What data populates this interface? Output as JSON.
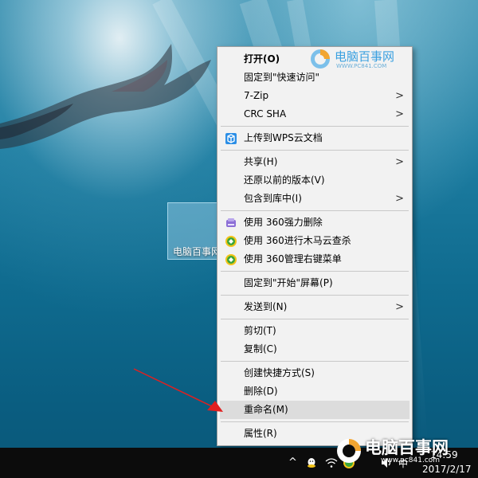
{
  "desktop": {
    "selected_icon_label": "电脑百事网"
  },
  "context_menu": {
    "items": [
      {
        "label": "打开(O)",
        "bold": true
      },
      {
        "label": "固定到\"快速访问\""
      },
      {
        "label": "7-Zip",
        "submenu": true
      },
      {
        "label": "CRC SHA",
        "submenu": true
      },
      {
        "label": "上传到WPS云文档",
        "icon": "wps-cloud-icon"
      },
      {
        "label": "共享(H)",
        "submenu": true
      },
      {
        "label": "还原以前的版本(V)"
      },
      {
        "label": "包含到库中(I)",
        "submenu": true
      },
      {
        "label": "使用 360强力删除",
        "icon": "360-shred-icon"
      },
      {
        "label": "使用 360进行木马云查杀",
        "icon": "360-scan-icon"
      },
      {
        "label": "使用 360管理右键菜单",
        "icon": "360-manage-icon"
      },
      {
        "label": "固定到\"开始\"屏幕(P)"
      },
      {
        "label": "发送到(N)",
        "submenu": true
      },
      {
        "label": "剪切(T)"
      },
      {
        "label": "复制(C)"
      },
      {
        "label": "创建快捷方式(S)"
      },
      {
        "label": "删除(D)"
      },
      {
        "label": "重命名(M)",
        "highlighted": true
      },
      {
        "label": "属性(R)"
      }
    ],
    "submenu_arrow": ">"
  },
  "watermark_top": {
    "name": "电脑百事网",
    "url": "WWW.PC841.COM"
  },
  "watermark_bottom": {
    "name": "电脑百事网",
    "url": "www.pc841.com"
  },
  "taskbar": {
    "time": "14:59",
    "date": "2017/2/17",
    "ime": "中",
    "chevron": "^"
  },
  "colors": {
    "menu_bg": "#f2f2f2",
    "menu_hover": "#dcdcdc",
    "arrow_red": "#e02020",
    "taskbar": "#0c0c0c"
  }
}
